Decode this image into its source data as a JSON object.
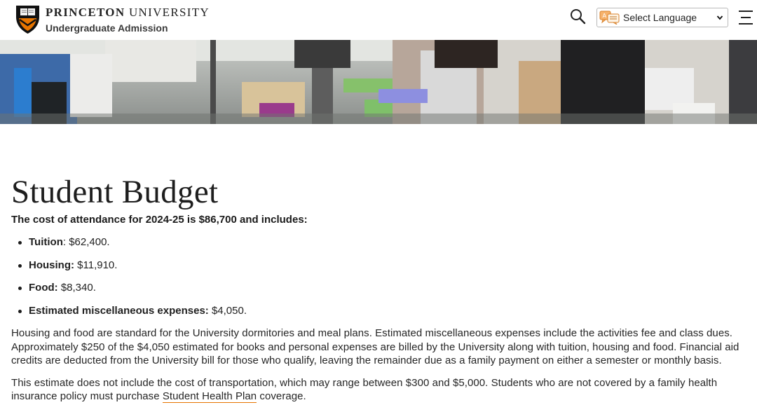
{
  "header": {
    "wordmark_bold": "PRINCETON",
    "wordmark_regular": "UNIVERSITY",
    "subtitle": "Undergraduate Admission",
    "search_icon": "search-icon",
    "language_select": {
      "value": "Select Language",
      "icon": "translate-icon"
    },
    "menu_icon": "hamburger-menu-icon"
  },
  "colors": {
    "accent": "#e77500",
    "shield_black": "#111111",
    "text": "#1a1a1a"
  },
  "main": {
    "title": "Student Budget",
    "intro": "The cost of attendance for 2024-25 is $86,700 and includes:",
    "costs": [
      {
        "label": "Tuition",
        "value": ": $62,400."
      },
      {
        "label": "Housing:",
        "value": " $11,910."
      },
      {
        "label": "Food:",
        "value": " $8,340."
      },
      {
        "label": "Estimated miscellaneous expenses:",
        "value": " $4,050."
      }
    ],
    "paragraph1": "Housing and food are standard for the University dormitories and meal plans. Estimated miscellaneous expenses include the activities fee and class dues. Approximately $250 of the $4,050 estimated for books and personal expenses are billed by the University along with tuition, housing and food. Financial aid credits are deducted from the University bill for those who qualify, leaving the remainder due as a family payment on either a semester or monthly basis.",
    "paragraph2_before": "This estimate does not include the cost of transportation, which may range between $300 and $5,000. Students who are not covered by a family health insurance policy must purchase ",
    "paragraph2_link": "Student Health Plan",
    "paragraph2_after": " coverage."
  }
}
